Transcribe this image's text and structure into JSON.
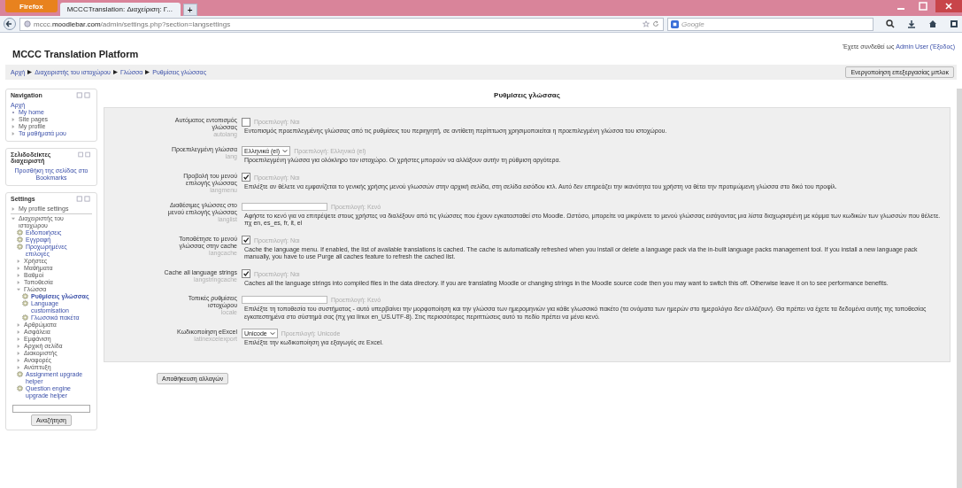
{
  "browser": {
    "menu_button": "Firefox",
    "tabs": [
      {
        "title": "MCCCTranslation: Διαχείριση: Γ...",
        "selected": true
      }
    ],
    "new_tab": "+",
    "url": {
      "prefix": "mccc.",
      "domain": "moodlebar.com",
      "path": "/admin/settings.php?section=langsettings"
    },
    "search": {
      "placeholder": "Google"
    }
  },
  "site": {
    "title": "MCCC Translation Platform",
    "login": {
      "text": "Έχετε συνδεθεί ως",
      "user": "Admin User",
      "logout": "(Έξοδος)"
    }
  },
  "breadcrumb": [
    "Αρχή",
    "Διαχειριστής του ιστοχώρου",
    "Γλώσσα",
    "Ρυθμίσεις γλώσσας"
  ],
  "edit_button": "Ενεργοποίηση επεξεργασίας μπλοκ",
  "navigation": {
    "title": "Navigation",
    "home": "Αρχή",
    "items": [
      {
        "label": "My home",
        "kind": "current"
      },
      {
        "label": "Site pages",
        "kind": "folder",
        "expanded": false
      },
      {
        "label": "My profile",
        "kind": "folder",
        "expanded": false
      },
      {
        "label": "Τα μαθήματά μου",
        "kind": "folder",
        "expanded": false
      }
    ]
  },
  "bookmarks": {
    "title": "Σελιδοδείκτες διαχειριστή",
    "link": "Προσθήκη της σελίδας στο Bookmarks"
  },
  "settings_block": {
    "title": "Settings",
    "items": [
      {
        "label": "My profile settings",
        "kind": "folder",
        "expanded": false
      },
      {
        "label": "Διαχειριστής του ιστοχώρου",
        "kind": "folder",
        "expanded": true,
        "children": [
          {
            "label": "Ειδοποιήσεις",
            "kind": "page",
            "selected": false
          },
          {
            "label": "Εγγραφή",
            "kind": "page",
            "selected": false
          },
          {
            "label": "Προχωρημένες επιλογές",
            "kind": "page",
            "selected": false
          },
          {
            "label": "Χρήστες",
            "kind": "folder",
            "expanded": false
          },
          {
            "label": "Μαθήματα",
            "kind": "folder",
            "expanded": false
          },
          {
            "label": "Βαθμοί",
            "kind": "folder",
            "expanded": false
          },
          {
            "label": "Τοποθεσία",
            "kind": "folder",
            "expanded": false
          },
          {
            "label": "Γλώσσα",
            "kind": "folder",
            "expanded": true,
            "children": [
              {
                "label": "Ρυθμίσεις γλώσσας",
                "kind": "page",
                "selected": true
              },
              {
                "label": "Language customisation",
                "kind": "page",
                "selected": false
              },
              {
                "label": "Γλωσσικά πακέτα",
                "kind": "page",
                "selected": false
              }
            ]
          },
          {
            "label": "Αρθρώματα",
            "kind": "folder",
            "expanded": false
          },
          {
            "label": "Ασφάλεια",
            "kind": "folder",
            "expanded": false
          },
          {
            "label": "Εμφάνιση",
            "kind": "folder",
            "expanded": false
          },
          {
            "label": "Αρχική σελίδα",
            "kind": "folder",
            "expanded": false
          },
          {
            "label": "Διακομιστής",
            "kind": "folder",
            "expanded": false
          },
          {
            "label": "Αναφορές",
            "kind": "folder",
            "expanded": false
          },
          {
            "label": "Ανάπτυξη",
            "kind": "folder",
            "expanded": false
          },
          {
            "label": "Assignment upgrade helper",
            "kind": "page",
            "selected": false
          },
          {
            "label": "Question engine upgrade helper",
            "kind": "page",
            "selected": false
          }
        ]
      }
    ],
    "search_button": "Αναζήτηση"
  },
  "page_title": "Ρυθμίσεις γλώσσας",
  "settings": [
    {
      "kind": "checkbox",
      "label": "Αυτόματος εντοπισμός γλώσσας",
      "key": "autolang",
      "checked": false,
      "default": "Προεπιλογή: Ναι",
      "description": "Εντοπισμός προεπιλεγμένης γλώσσας από τις ρυθμίσεις του περιηγητή, σε αντίθετη περίπτωση χρησιμοποιείται η προεπιλεγμένη γλώσσα του ιστοχώρου."
    },
    {
      "kind": "select",
      "label": "Προεπιλεγμένη γλώσσα",
      "key": "lang",
      "value": "Ελληνικά (el)",
      "default": "Προεπιλογή: Ελληνικά (el)",
      "description": "Προεπιλεγμένη γλώσσα για ολόκληρο τον ιστοχώρο. Οι χρήστες μπορούν να αλλάξουν αυτήν τη ρύθμιση αργότερα."
    },
    {
      "kind": "checkbox",
      "label": "Προβολή του μενού επιλογής γλώσσας",
      "key": "langmenu",
      "checked": true,
      "default": "Προεπιλογή: Ναι",
      "description": "Επιλέξτε αν θέλετε να εμφανίζεται το γενικής χρήσης μενού γλωσσών στην αρχική σελίδα, στη σελίδα εισόδου κτλ. Αυτό δεν επηρεάζει την ικανότητα του χρήστη να θέτει την προτιμώμενη γλώσσα στο δικό του προφίλ."
    },
    {
      "kind": "text",
      "label": "Διαθέσιμες γλώσσες στο μενού επιλογής γλώσσας",
      "key": "langlist",
      "default": "Προεπιλογή: Κενό",
      "description": "Αφήστε το κενό για να επιτρέψετε στους χρήστες να διαλέξουν από τις γλώσσες που έχουν εγκατασταθεί στο Moodle. Ωστόσο, μπορείτε να μικρύνετε το μενού γλώσσας εισάγοντας μια λίστα διαχωρισμένη με κόμμα των κωδικών των γλωσσών που θέλετε. πχ en, es_es, fr, it, el"
    },
    {
      "kind": "checkbox",
      "label": "Τοποθέτησε το μενού γλώσσας στην cache",
      "key": "langcache",
      "checked": true,
      "default": "Προεπιλογή: Ναι",
      "description": "Cache the language menu. If enabled, the list of available translations is cached. The cache is automatically refreshed when you install or delete a language pack via the in-built language packs management tool. If you install a new language pack manually, you have to use Purge all caches feature to refresh the cached list."
    },
    {
      "kind": "checkbox",
      "label": "Cache all language strings",
      "key": "langstringcache",
      "checked": true,
      "default": "Προεπιλογή: Ναι",
      "description": "Caches all the language strings into compiled files in the data directory. If you are translating Moodle or changing strings in the Moodle source code then you may want to switch this off. Otherwise leave it on to see performance benefits."
    },
    {
      "kind": "text",
      "label": "Τοπικές ρυθμίσεις ιστοχώρου",
      "key": "locale",
      "default": "Προεπιλογή: Κενό",
      "description": "Επιλέξτε τη τοποθεσία του συστήματος - αυτό υπερβαίνει την μορφοποίηση και την γλώσσα των ημερομηνιών για κάθε γλωσσικό πακέτο (τα ονόματα των ημερών στο ημερολόγιο δεν αλλάζουν). Θα πρέπει να έχετε τα δεδομένα αυτής της τοποθεσίας εγκατεστημένα στο σύστημά σας (πχ για linux en_US.UTF-8). Στις περισσότερες περιπτώσεις αυτό το πεδίο πρέπει να μένει κενό."
    },
    {
      "kind": "select",
      "label": "Κωδικοποίηση eExcel",
      "key": "latinexcelexport",
      "value": "Unicode",
      "default": "Προεπιλογή: Unicode",
      "description": "Επιλέξτε την κωδικοποίηση για εξαγωγές σε Excel."
    }
  ],
  "save_button": "Αποθήκευση αλλαγών"
}
